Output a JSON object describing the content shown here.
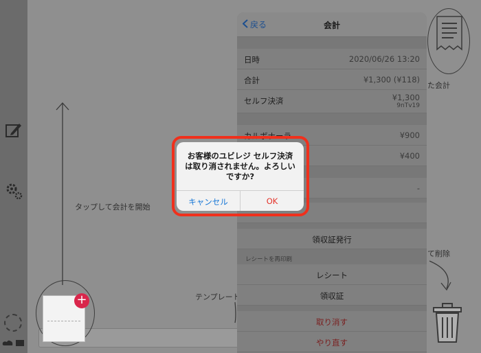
{
  "canvas": {
    "tap_hint": "タップして会計を開始",
    "template_hint": "テンプレート",
    "receipt_hint": "た会計",
    "delete_hint": "て削除"
  },
  "sheet": {
    "back_label": "戻る",
    "title": "会計",
    "info_rows": [
      {
        "label": "日時",
        "value": "2020/06/26 13:20"
      },
      {
        "label": "合計",
        "value": "¥1,300 (¥118)"
      }
    ],
    "payment": {
      "label": "セルフ決済",
      "value": "¥1,300",
      "sub": "9nTv19"
    },
    "items": [
      {
        "label": "カルボナーラ",
        "value": "¥900"
      },
      {
        "label": "",
        "value": "¥400"
      }
    ],
    "misc_row": {
      "label": "",
      "value": "-"
    },
    "issue_receipt": "領収証発行",
    "reprint_label": "レシートを再印刷",
    "reprint_receipt": "レシート",
    "reprint_invoice": "領収証",
    "cancel_action": "取り消す",
    "redo_action": "やり直す"
  },
  "alert": {
    "message": "お客様のユビレジ セルフ決済は取り消されません。よろしいですか?",
    "cancel_label": "キャンセル",
    "ok_label": "OK"
  },
  "colors": {
    "accent": "#1777d6",
    "destructive": "#e4332a",
    "highlight": "#f0301c",
    "badge": "#d9264b"
  }
}
